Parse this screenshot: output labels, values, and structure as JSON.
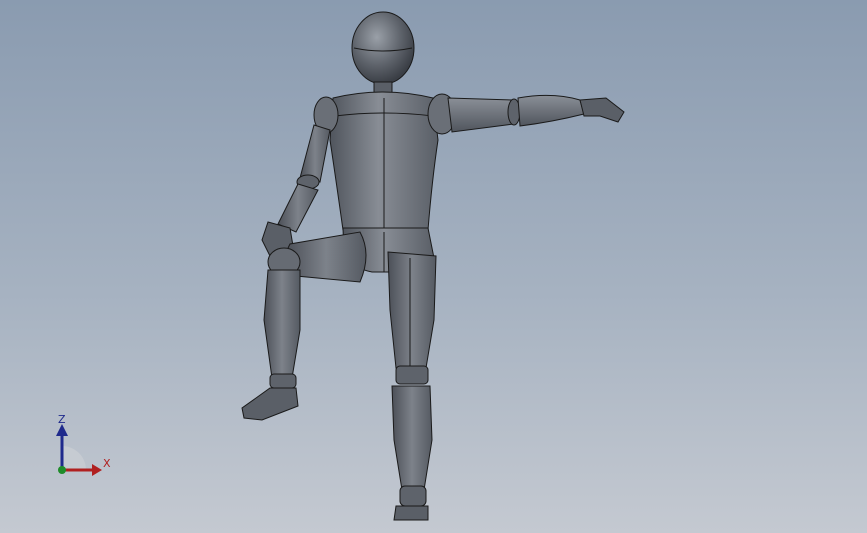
{
  "viewport": {
    "background_top": "#8a9bb0",
    "background_bottom": "#c4c9d1",
    "model_color": "#6d717a",
    "edge_color": "#1a1a1a"
  },
  "triad": {
    "z_label": "Z",
    "x_label": "X",
    "z_color": "#1f2a8c",
    "x_color": "#b02020",
    "y_color": "#1f8c2a"
  }
}
